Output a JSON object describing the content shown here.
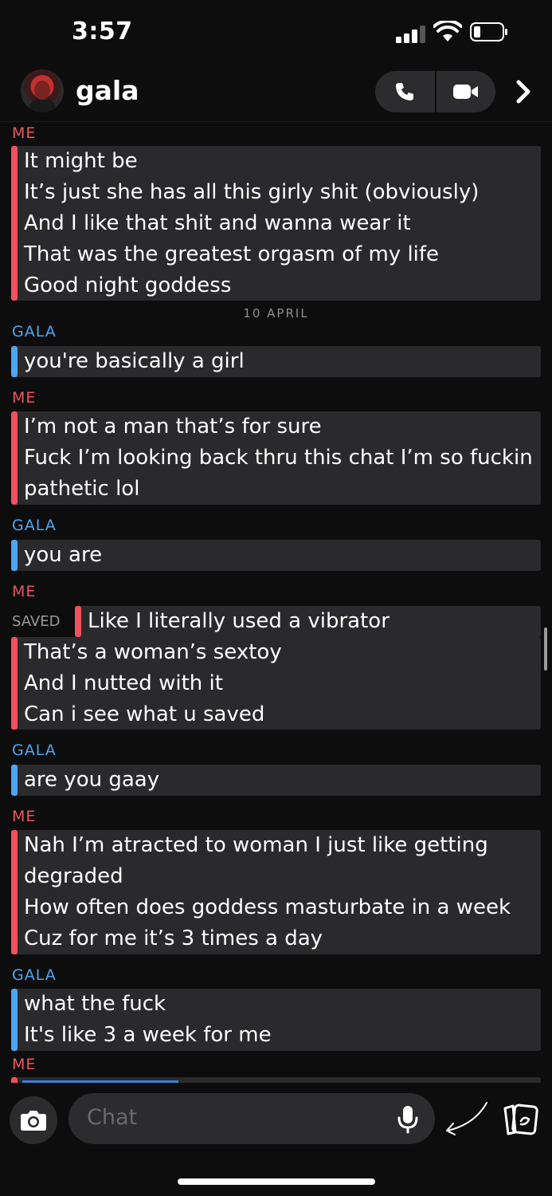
{
  "status_bar": {
    "time": "3:57"
  },
  "header": {
    "contact_name": "gala"
  },
  "messages": {
    "group1": {
      "sender": "ME",
      "lines": [
        "It might be",
        "It’s just she has all this girly shit (obviously)",
        "And I like that shit and wanna wear it",
        "That was the greatest orgasm of my life",
        "Good night goddess"
      ]
    },
    "date_separator": "10 APRIL",
    "group2": {
      "sender": "GALA",
      "lines": [
        "you're basically a girl"
      ]
    },
    "group3": {
      "sender": "ME",
      "lines": [
        "I’m not a man that’s for sure",
        "Fuck I’m looking back thru this chat I’m so fuckin",
        "pathetic lol"
      ]
    },
    "group4": {
      "sender": "GALA",
      "lines": [
        "you are"
      ]
    },
    "group5": {
      "sender": "ME",
      "saved_label": "SAVED",
      "lines": [
        "Like I literally used a vibrator",
        "That’s a woman’s sextoy",
        "And I nutted with it",
        "Can i see what u saved"
      ]
    },
    "group6": {
      "sender": "GALA",
      "lines": [
        "are you gaay"
      ]
    },
    "group7": {
      "sender": "ME",
      "lines": [
        "Nah I’m atracted to woman I just like getting",
        "degraded",
        "How often does goddess masturbate in a week",
        "Cuz for me it’s 3 times a day"
      ]
    },
    "group8": {
      "sender": "GALA",
      "lines": [
        "what the fuck",
        "It's like 3 a week for me"
      ]
    },
    "group9": {
      "sender": "ME"
    }
  },
  "input": {
    "placeholder": "Chat"
  },
  "colors": {
    "me_accent": "#f0525c",
    "gala_accent": "#4ea6f2",
    "bubble_bg": "#2a2a2c",
    "background": "#0d0d0d"
  },
  "icons": [
    "signal-icon",
    "wifi-icon",
    "battery-icon",
    "phone-icon",
    "video-camera-icon",
    "chevron-right-icon",
    "camera-icon",
    "microphone-icon",
    "arrow-annotation-icon",
    "cards-icon"
  ]
}
